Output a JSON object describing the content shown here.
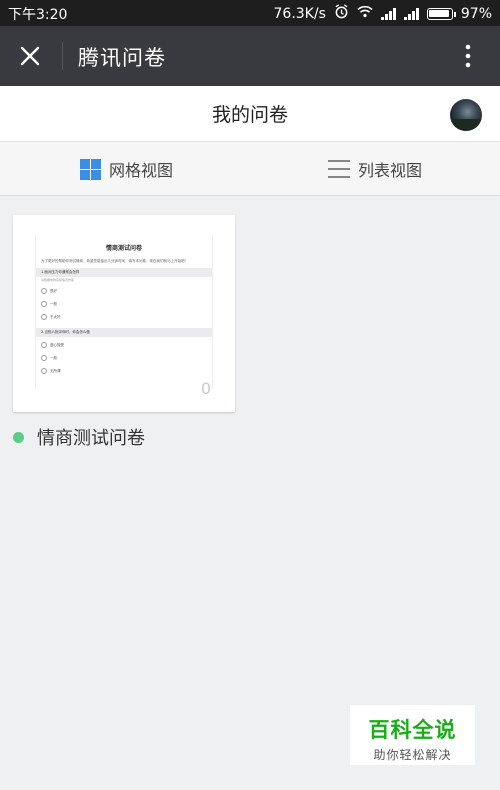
{
  "status_bar": {
    "time": "下午3:20",
    "net_speed": "76.3K/s",
    "battery": "97%",
    "battery_level": 0.97
  },
  "title_bar": {
    "title": "腾讯问卷",
    "close_icon": "close-icon",
    "more_icon": "more-vertical-icon"
  },
  "header": {
    "title": "我的问卷"
  },
  "view_switch": {
    "grid_label": "网格视图",
    "list_label": "列表视图",
    "active": "grid",
    "accent": "#3c8ee2"
  },
  "surveys": [
    {
      "name": "情商测试问卷",
      "count": "0",
      "status_color": "#5bcc8a",
      "preview": {
        "title": "情商测试问卷",
        "description": "为了更好的帮助你测试情商，希望您能抽出几分钟时间，填写本问卷，现在我们就马上开始吧！",
        "q1": "1.面对压力你通常会怎样",
        "q1_hint": "请根据你的实际情况作答",
        "q1_options": [
          "很好",
          "一般",
          "不太好"
        ],
        "q2": "2.当别人批评你时，你会怎么做",
        "q2_options": [
          "虚心接受",
          "一般",
          "无所谓"
        ]
      }
    }
  ],
  "watermark": {
    "main": "百科全说",
    "sub": "助你轻松解决"
  }
}
